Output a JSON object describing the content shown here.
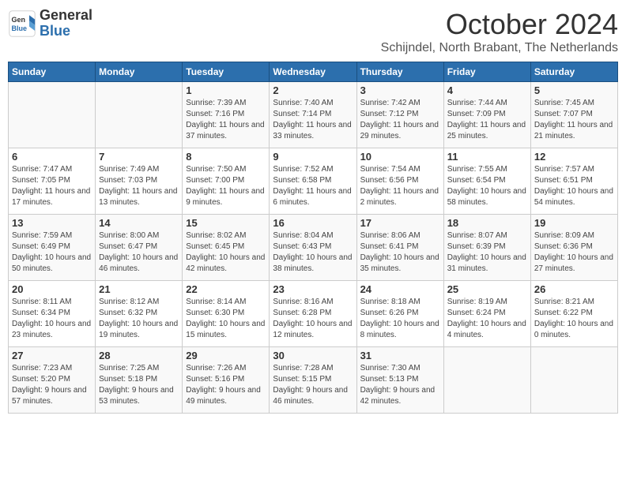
{
  "logo": {
    "general": "General",
    "blue": "Blue"
  },
  "title": "October 2024",
  "location": "Schijndel, North Brabant, The Netherlands",
  "days_of_week": [
    "Sunday",
    "Monday",
    "Tuesday",
    "Wednesday",
    "Thursday",
    "Friday",
    "Saturday"
  ],
  "weeks": [
    [
      {
        "num": "",
        "info": ""
      },
      {
        "num": "",
        "info": ""
      },
      {
        "num": "1",
        "info": "Sunrise: 7:39 AM\nSunset: 7:16 PM\nDaylight: 11 hours and 37 minutes."
      },
      {
        "num": "2",
        "info": "Sunrise: 7:40 AM\nSunset: 7:14 PM\nDaylight: 11 hours and 33 minutes."
      },
      {
        "num": "3",
        "info": "Sunrise: 7:42 AM\nSunset: 7:12 PM\nDaylight: 11 hours and 29 minutes."
      },
      {
        "num": "4",
        "info": "Sunrise: 7:44 AM\nSunset: 7:09 PM\nDaylight: 11 hours and 25 minutes."
      },
      {
        "num": "5",
        "info": "Sunrise: 7:45 AM\nSunset: 7:07 PM\nDaylight: 11 hours and 21 minutes."
      }
    ],
    [
      {
        "num": "6",
        "info": "Sunrise: 7:47 AM\nSunset: 7:05 PM\nDaylight: 11 hours and 17 minutes."
      },
      {
        "num": "7",
        "info": "Sunrise: 7:49 AM\nSunset: 7:03 PM\nDaylight: 11 hours and 13 minutes."
      },
      {
        "num": "8",
        "info": "Sunrise: 7:50 AM\nSunset: 7:00 PM\nDaylight: 11 hours and 9 minutes."
      },
      {
        "num": "9",
        "info": "Sunrise: 7:52 AM\nSunset: 6:58 PM\nDaylight: 11 hours and 6 minutes."
      },
      {
        "num": "10",
        "info": "Sunrise: 7:54 AM\nSunset: 6:56 PM\nDaylight: 11 hours and 2 minutes."
      },
      {
        "num": "11",
        "info": "Sunrise: 7:55 AM\nSunset: 6:54 PM\nDaylight: 10 hours and 58 minutes."
      },
      {
        "num": "12",
        "info": "Sunrise: 7:57 AM\nSunset: 6:51 PM\nDaylight: 10 hours and 54 minutes."
      }
    ],
    [
      {
        "num": "13",
        "info": "Sunrise: 7:59 AM\nSunset: 6:49 PM\nDaylight: 10 hours and 50 minutes."
      },
      {
        "num": "14",
        "info": "Sunrise: 8:00 AM\nSunset: 6:47 PM\nDaylight: 10 hours and 46 minutes."
      },
      {
        "num": "15",
        "info": "Sunrise: 8:02 AM\nSunset: 6:45 PM\nDaylight: 10 hours and 42 minutes."
      },
      {
        "num": "16",
        "info": "Sunrise: 8:04 AM\nSunset: 6:43 PM\nDaylight: 10 hours and 38 minutes."
      },
      {
        "num": "17",
        "info": "Sunrise: 8:06 AM\nSunset: 6:41 PM\nDaylight: 10 hours and 35 minutes."
      },
      {
        "num": "18",
        "info": "Sunrise: 8:07 AM\nSunset: 6:39 PM\nDaylight: 10 hours and 31 minutes."
      },
      {
        "num": "19",
        "info": "Sunrise: 8:09 AM\nSunset: 6:36 PM\nDaylight: 10 hours and 27 minutes."
      }
    ],
    [
      {
        "num": "20",
        "info": "Sunrise: 8:11 AM\nSunset: 6:34 PM\nDaylight: 10 hours and 23 minutes."
      },
      {
        "num": "21",
        "info": "Sunrise: 8:12 AM\nSunset: 6:32 PM\nDaylight: 10 hours and 19 minutes."
      },
      {
        "num": "22",
        "info": "Sunrise: 8:14 AM\nSunset: 6:30 PM\nDaylight: 10 hours and 15 minutes."
      },
      {
        "num": "23",
        "info": "Sunrise: 8:16 AM\nSunset: 6:28 PM\nDaylight: 10 hours and 12 minutes."
      },
      {
        "num": "24",
        "info": "Sunrise: 8:18 AM\nSunset: 6:26 PM\nDaylight: 10 hours and 8 minutes."
      },
      {
        "num": "25",
        "info": "Sunrise: 8:19 AM\nSunset: 6:24 PM\nDaylight: 10 hours and 4 minutes."
      },
      {
        "num": "26",
        "info": "Sunrise: 8:21 AM\nSunset: 6:22 PM\nDaylight: 10 hours and 0 minutes."
      }
    ],
    [
      {
        "num": "27",
        "info": "Sunrise: 7:23 AM\nSunset: 5:20 PM\nDaylight: 9 hours and 57 minutes."
      },
      {
        "num": "28",
        "info": "Sunrise: 7:25 AM\nSunset: 5:18 PM\nDaylight: 9 hours and 53 minutes."
      },
      {
        "num": "29",
        "info": "Sunrise: 7:26 AM\nSunset: 5:16 PM\nDaylight: 9 hours and 49 minutes."
      },
      {
        "num": "30",
        "info": "Sunrise: 7:28 AM\nSunset: 5:15 PM\nDaylight: 9 hours and 46 minutes."
      },
      {
        "num": "31",
        "info": "Sunrise: 7:30 AM\nSunset: 5:13 PM\nDaylight: 9 hours and 42 minutes."
      },
      {
        "num": "",
        "info": ""
      },
      {
        "num": "",
        "info": ""
      }
    ]
  ]
}
